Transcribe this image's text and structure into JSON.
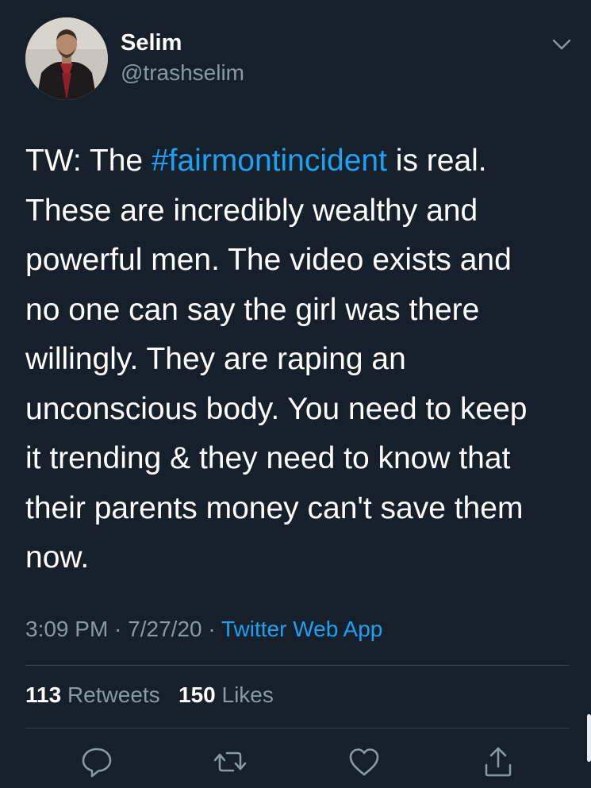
{
  "tweet": {
    "author": {
      "display_name": "Selim",
      "handle": "@trashselim"
    },
    "text_lines": [
      {
        "before": "TW: The ",
        "hashtag": "#fairmontincident",
        "after": " is real."
      },
      {
        "text": "These are incredibly wealthy and"
      },
      {
        "text": "powerful men. The video exists and"
      },
      {
        "text": "no one can say the girl was there"
      },
      {
        "text": "willingly. They are raping an"
      },
      {
        "text": "unconscious body. You need to keep"
      },
      {
        "text": "it trending & they need to know that"
      },
      {
        "text": "their parents money can't save them"
      },
      {
        "text": "now."
      }
    ],
    "time": "3:09 PM",
    "date": "7/27/20",
    "separator": " · ",
    "source": "Twitter Web App",
    "stats": {
      "retweets_count": "113",
      "retweets_label": "Retweets",
      "likes_count": "150",
      "likes_label": "Likes"
    },
    "icons": {
      "more": "chevron-down-icon",
      "reply": "reply-icon",
      "retweet": "retweet-icon",
      "like": "heart-icon",
      "share": "share-icon"
    },
    "colors": {
      "background": "#15202b",
      "accent": "#1da1f2",
      "secondary_text": "#8899a6",
      "divider": "#38444d"
    }
  }
}
